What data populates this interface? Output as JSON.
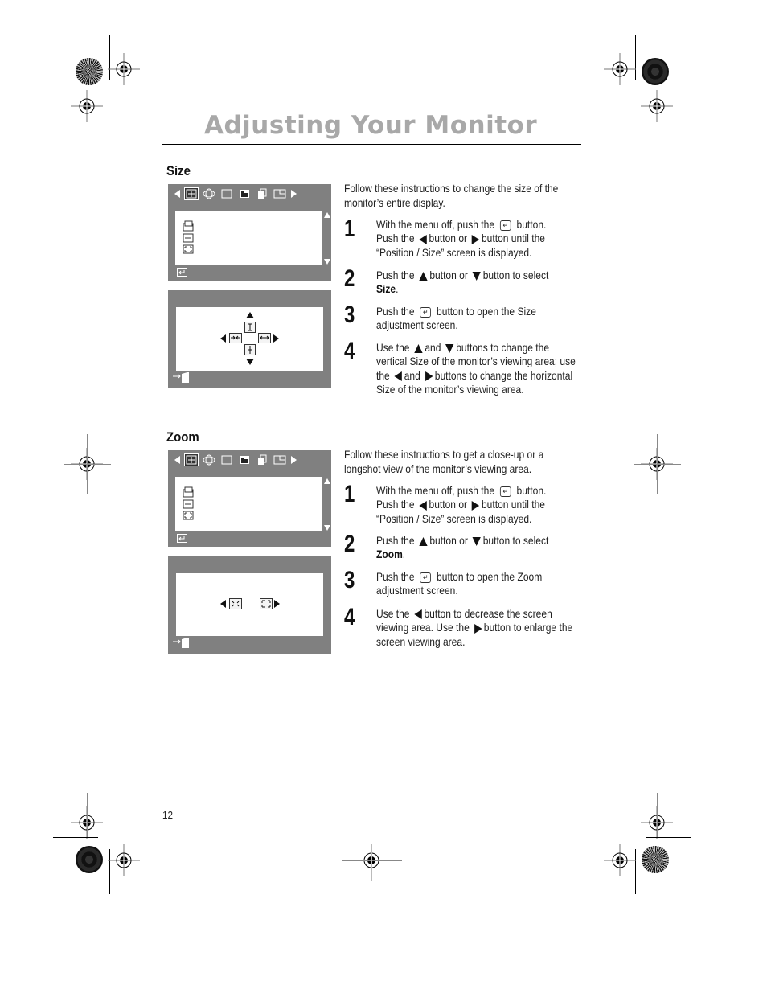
{
  "page": {
    "title": "Adjusting Your Monitor",
    "page_number": "12"
  },
  "sections": [
    {
      "heading": "Size",
      "intro": "Follow these instructions to change the size of the monitor’s entire display.",
      "steps": [
        {
          "num": "1",
          "parts": [
            "With the menu off, push the",
            "button.",
            "Push the",
            "button or",
            "button until the",
            "“Position / Size” screen is displayed."
          ]
        },
        {
          "num": "2",
          "parts": [
            "Push the",
            "button or",
            "button to select",
            "Size",
            "."
          ]
        },
        {
          "num": "3",
          "parts": [
            "Push the",
            "button to open the Size adjustment screen."
          ]
        },
        {
          "num": "4",
          "parts": [
            "Use the",
            "and",
            "buttons to change the vertical Size of the monitor’s viewing area; use the",
            "and",
            "buttons to change the horizontal Size of the monitor’s viewing area."
          ]
        }
      ],
      "osd_menu": {
        "icons": [
          "left-arrow",
          "position-size-icon",
          "geometry-icon",
          "screen-icon",
          "color-icon",
          "copy-icon",
          "window-icon",
          "right-arrow"
        ],
        "selected": "position-size-icon",
        "items": [
          "position-icon",
          "size-icon",
          "zoom-icon"
        ],
        "footer": "enter-icon"
      },
      "osd_adjust": {
        "type": "size",
        "footer": "exit-icon"
      }
    },
    {
      "heading": "Zoom",
      "intro": "Follow these instructions to get a close-up or a longshot view of the monitor’s viewing area.",
      "steps": [
        {
          "num": "1",
          "parts": [
            "With the menu off, push the",
            "button.",
            "Push the",
            "button or",
            "button until the",
            "“Position / Size” screen is displayed."
          ]
        },
        {
          "num": "2",
          "parts": [
            "Push the",
            "button or",
            "button to select",
            "Zoom",
            "."
          ]
        },
        {
          "num": "3",
          "parts": [
            "Push the",
            "button to open the Zoom adjustment screen."
          ]
        },
        {
          "num": "4",
          "parts": [
            "Use the",
            "button to decrease the screen viewing area. Use the",
            "button to enlarge the screen viewing area."
          ]
        }
      ],
      "osd_menu": {
        "icons": [
          "left-arrow",
          "position-size-icon",
          "geometry-icon",
          "screen-icon",
          "color-icon",
          "copy-icon",
          "window-icon",
          "right-arrow"
        ],
        "selected": "position-size-icon",
        "items": [
          "position-icon",
          "size-icon",
          "zoom-icon"
        ],
        "footer": "enter-icon"
      },
      "osd_adjust": {
        "type": "zoom",
        "footer": "exit-icon"
      }
    }
  ],
  "colors": {
    "title": "#a8a8a8",
    "osd_frame": "#808080",
    "osd_screen": "#ffffff"
  }
}
